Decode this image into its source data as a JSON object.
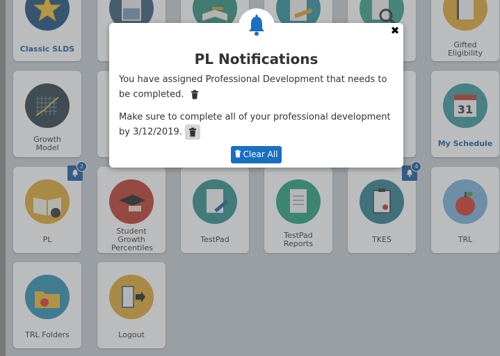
{
  "tiles": {
    "classic_slds": "Classic SLDS",
    "gifted_eligibility": "Gifted Eligibility",
    "growth_model": "Growth Model",
    "my_schedule": "My Schedule",
    "pl": "PL",
    "student_growth": "Student Growth Percentiles",
    "testpad": "TestPad",
    "testpad_reports": "TestPad Reports",
    "tkes": "TKES",
    "trl": "TRL",
    "trl_folders": "TRL Folders",
    "logout": "Logout"
  },
  "badges": {
    "pl": "2",
    "tkes": "4"
  },
  "calendar_day": "31",
  "modal": {
    "title": "PL Notifications",
    "messages": [
      "You have assigned Professional Development that needs to be completed.",
      "Make sure to complete all of your professional development by 3/12/2019."
    ],
    "clear_label": "Clear All",
    "close_symbol": "✖"
  },
  "colors": {
    "accent": "#1a6fc0",
    "badge": "#1a5a9a",
    "page_bg": "#c9cdd0"
  },
  "icons": [
    "star-icon",
    "calculator-icon",
    "book-icon",
    "pencil-icon",
    "magnifier-icon",
    "notebook-icon",
    "growth-chart-icon",
    "calendar-icon",
    "open-book-icon",
    "graduation-cap-icon",
    "testpad-icon",
    "report-icon",
    "clipboard-icon",
    "apple-icon",
    "folder-icon",
    "logout-door-icon",
    "bell-icon",
    "trash-icon",
    "close-icon"
  ]
}
